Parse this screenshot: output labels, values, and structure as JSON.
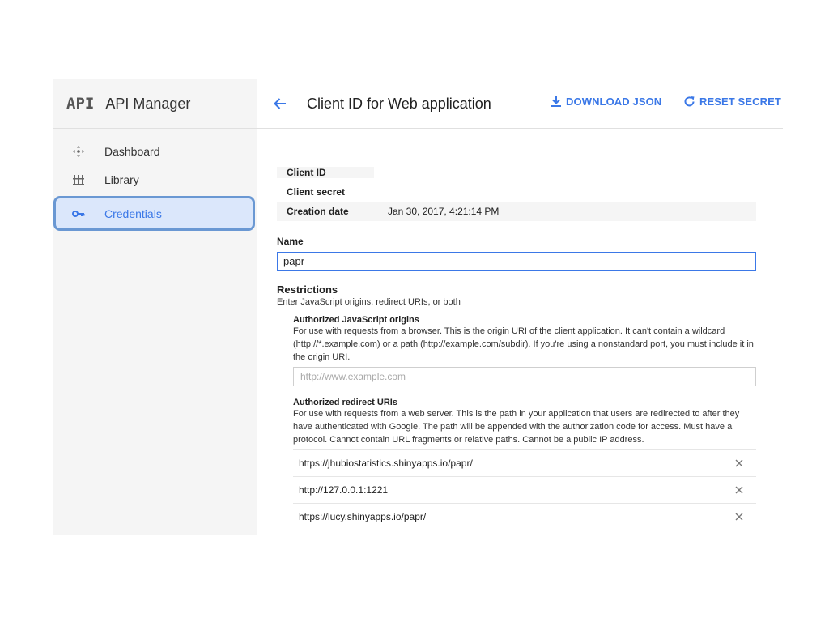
{
  "sidebar": {
    "brand_logo": "API",
    "brand_title": "API Manager",
    "items": [
      {
        "label": "Dashboard",
        "icon": "dashboard-icon"
      },
      {
        "label": "Library",
        "icon": "library-icon"
      },
      {
        "label": "Credentials",
        "icon": "key-icon",
        "active": true
      }
    ]
  },
  "header": {
    "title": "Client ID for Web application",
    "download_label": "DOWNLOAD JSON",
    "reset_label": "RESET SECRET",
    "accent_color": "#3b78e7"
  },
  "client_info": {
    "client_id_label": "Client ID",
    "client_id_value": "",
    "client_secret_label": "Client secret",
    "client_secret_value": "",
    "creation_date_label": "Creation date",
    "creation_date_value": "Jan 30, 2017, 4:21:14 PM"
  },
  "name_field": {
    "label": "Name",
    "value": "papr"
  },
  "restrictions": {
    "title": "Restrictions",
    "subtitle": "Enter JavaScript origins, redirect URIs, or both",
    "js_origins": {
      "title": "Authorized JavaScript origins",
      "description": "For use with requests from a browser. This is the origin URI of the client application. It can't contain a wildcard (http://*.example.com) or a path (http://example.com/subdir). If you're using a nonstandard port, you must include it in the origin URI.",
      "placeholder": "http://www.example.com"
    },
    "redirect_uris": {
      "title": "Authorized redirect URIs",
      "description": "For use with requests from a web server. This is the path in your application that users are redirected to after they have authenticated with Google. The path will be appended with the authorization code for access. Must have a protocol. Cannot contain URL fragments or relative paths. Cannot be a public IP address.",
      "items": [
        "https://jhubiostatistics.shinyapps.io/papr/",
        "http://127.0.0.1:1221",
        "https://lucy.shinyapps.io/papr/"
      ]
    }
  }
}
